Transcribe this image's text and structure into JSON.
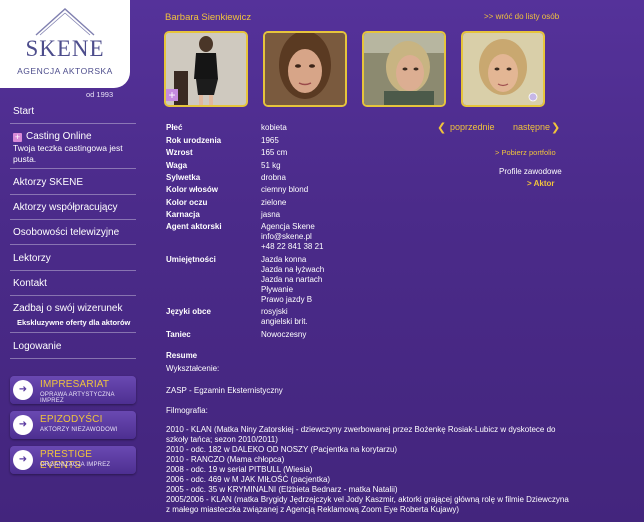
{
  "logo": {
    "name": "SKENE",
    "subtitle": "AGENCJA AKTORSKA",
    "since": "od 1993"
  },
  "nav": {
    "start": "Start",
    "casting": "Casting Online",
    "casting_note": "Twoja teczka castingowa jest pusta.",
    "aktorzy": "Aktorzy SKENE",
    "wspolpracujacy": "Aktorzy współpracujący",
    "osobowosci": "Osobowości telewizyjne",
    "lektorzy": "Lektorzy",
    "kontakt": "Kontakt",
    "wizerunek": "Zadbaj o swój wizerunek",
    "wizerunek_sub": "Ekskluzywne oferty dla aktorów",
    "logowanie": "Logowanie"
  },
  "promos": [
    {
      "title": "IMPRESARIAT",
      "sub": "OPRAWA ARTYSTYCZNA IMPREZ"
    },
    {
      "title": "EPIZODYŚCI",
      "sub": "AKTORZY NIEZAWODOWI"
    },
    {
      "title": "PRESTIGE EVENTS",
      "sub": "ORGANIZACJA IMPREZ"
    }
  ],
  "actor": {
    "name": "Barbara Sienkiewicz"
  },
  "back_link": ">> wróć do listy osób",
  "pager": {
    "prev": "poprzednie",
    "next": "następne"
  },
  "portfolio": "> Pobierz portfolio",
  "profile": {
    "label": "Profile zawodowe",
    "value": "> Aktor"
  },
  "details": {
    "plec": {
      "label": "Płeć",
      "value": "kobieta"
    },
    "rok": {
      "label": "Rok urodzenia",
      "value": "1965"
    },
    "wzrost": {
      "label": "Wzrost",
      "value": "165 cm"
    },
    "waga": {
      "label": "Waga",
      "value": "51 kg"
    },
    "sylwetka": {
      "label": "Sylwetka",
      "value": "drobna"
    },
    "wlosy": {
      "label": "Kolor włosów",
      "value": "ciemny blond"
    },
    "oczy": {
      "label": "Kolor oczu",
      "value": "zielone"
    },
    "karnacja": {
      "label": "Karnacja",
      "value": "jasna"
    },
    "agent": {
      "label": "Agent aktorski",
      "lines": [
        "Agencja Skene",
        "info@skene.pl",
        "+48 22 841 38 21"
      ]
    },
    "umiejetnosci": {
      "label": "Umiejętności",
      "lines": [
        "Jazda konna",
        "Jazda na łyżwach",
        "Jazda na nartach",
        "Pływanie",
        "Prawo jazdy B"
      ]
    },
    "jezyki": {
      "label": "Języki obce",
      "lines": [
        "rosyjski",
        "angielski brit."
      ]
    },
    "taniec": {
      "label": "Taniec",
      "value": "Nowoczesny"
    }
  },
  "resume": {
    "label": "Resume",
    "wyksztalcenie_label": "Wykształcenie:",
    "wyksztalcenie": "ZASP - Egzamin Eksternistyczny",
    "filmografia_label": "Filmografia:",
    "filmografia": [
      "2010 - KLAN (Matka Niny Zatorskiej - dziewczyny zwerbowanej przez Bożenkę Rosiak-Lubicz w dyskotece do",
      "szkoły tańca; sezon 2010/2011)",
      "2010 - odc. 182 w DALEKO OD NOSZY (Pacjentka na korytarzu)",
      "2010 - RANCZO (Mama chłopca)",
      "2008 - odc. 19 w serial PITBULL (Wiesia)",
      "2006 - odc. 469 w M JAK MIŁOŚĆ (pacjentka)",
      "2005 - odc. 35 w KRYMINALNI (Elżbieta Bednarz - matka Natalii)",
      "2005/2006 - KLAN (matka Brygidy Jędrzejczyk vel Jody Kaszmir, aktorki grającej główną rolę w filmie Dziewczyna",
      "z małego miasteczka związanej z Agencją Reklamową Zoom Eye Roberta Kujawy)"
    ]
  },
  "colors": {
    "accent": "#f0c33c",
    "background": "#4a2a86"
  }
}
